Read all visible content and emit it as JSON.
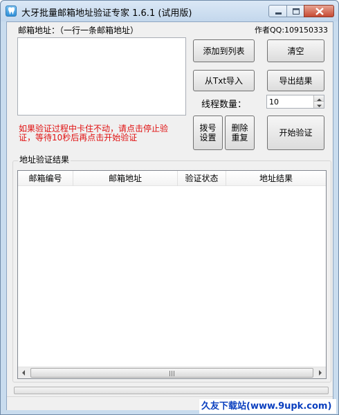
{
  "window": {
    "title": "大牙批量邮箱地址验证专家 1.6.1 (试用版)",
    "controls": {
      "minimize": "minimize",
      "maximize": "maximize",
      "close": "close"
    }
  },
  "form": {
    "email_label": "邮箱地址：（一行一条邮箱地址）",
    "author_label": "作者QQ:109150333",
    "email_input_value": "",
    "hint_line1": "如果验证过程中卡住不动，请点击停止验",
    "hint_line2": "证，等待10秒后再点击开始验证",
    "thread_label": "线程数量：",
    "thread_value": "10"
  },
  "buttons": {
    "add_to_list": "添加到列表",
    "clear": "清空",
    "import_txt": "从Txt导入",
    "export": "导出结果",
    "dial_settings_l1": "拨号",
    "dial_settings_l2": "设置",
    "dedupe_l1": "删除",
    "dedupe_l2": "重复",
    "start": "开始验证"
  },
  "results": {
    "group_title": "地址验证结果",
    "columns": [
      "邮箱编号",
      "邮箱地址",
      "验证状态",
      "地址结果"
    ],
    "rows": []
  },
  "watermark": "久友下载站(www.9upk.com)",
  "colors": {
    "hint_red": "#e01010",
    "close_button": "#c64a33",
    "watermark_blue": "#0a3fbf"
  }
}
